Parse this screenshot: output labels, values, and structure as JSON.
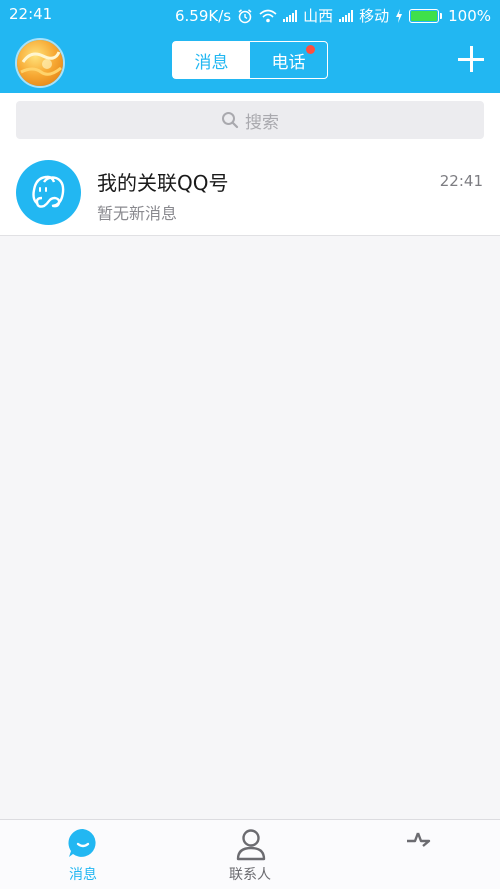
{
  "status_bar": {
    "time": "22:41",
    "net_speed": "6.59K/s",
    "carrier1": "山西",
    "carrier2": "移动",
    "battery": "100%"
  },
  "header": {
    "tab_messages": "消息",
    "tab_calls": "电话"
  },
  "search": {
    "placeholder": "搜索"
  },
  "conversations": [
    {
      "name": "我的关联QQ号",
      "preview": "暂无新消息",
      "time": "22:41"
    }
  ],
  "bottom_nav": [
    {
      "label": "消息",
      "active": true
    },
    {
      "label": "联系人",
      "active": false
    }
  ],
  "colors": {
    "accent": "#22b7f2",
    "badge": "#ff4f3e",
    "battery": "#3fe04b"
  }
}
